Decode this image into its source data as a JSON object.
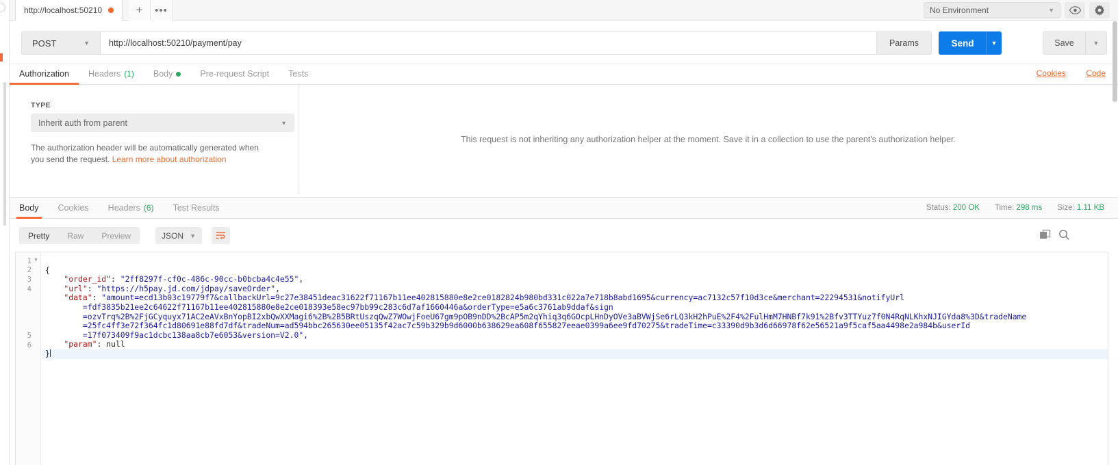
{
  "window": {
    "tab_label": "http://localhost:50210",
    "new_tab_icon": "+",
    "more_tabs_icon": "•••",
    "environment": "No Environment",
    "eye_icon": "eye-icon",
    "gear_icon": "gear-icon"
  },
  "request": {
    "method": "POST",
    "url": "http://localhost:50210/payment/pay",
    "params_label": "Params",
    "send_label": "Send",
    "save_label": "Save",
    "tabs": [
      {
        "label": "Authorization",
        "badge": ""
      },
      {
        "label": "Headers",
        "badge": "(1)"
      },
      {
        "label": "Body",
        "badge": ""
      },
      {
        "label": "Pre-request Script",
        "badge": ""
      },
      {
        "label": "Tests",
        "badge": ""
      }
    ],
    "cookies_link": "Cookies",
    "code_link": "Code"
  },
  "auth": {
    "type_label": "TYPE",
    "type_value": "Inherit auth from parent",
    "note_text": "The authorization header will be automatically generated when you send the request. ",
    "note_link": "Learn more about authorization",
    "right_message": "This request is not inheriting any authorization helper at the moment. Save it in a collection to use the parent's authorization helper."
  },
  "response": {
    "tabs": [
      {
        "label": "Body",
        "badge": ""
      },
      {
        "label": "Cookies",
        "badge": ""
      },
      {
        "label": "Headers",
        "badge": "(6)"
      },
      {
        "label": "Test Results",
        "badge": ""
      }
    ],
    "status_label": "Status:",
    "status_value": "200 OK",
    "time_label": "Time:",
    "time_value": "298 ms",
    "size_label": "Size:",
    "size_value": "1.11 KB",
    "view_modes": [
      "Pretty",
      "Raw",
      "Preview"
    ],
    "active_view": "Pretty",
    "format": "JSON",
    "wrap_icon": "word-wrap-icon",
    "copy_icon": "copy-icon",
    "search_icon": "search-icon"
  },
  "body_json": {
    "line_numbers": [
      "1",
      "2",
      "3",
      "4",
      "5",
      "6"
    ],
    "lines": [
      "{",
      "    \"order_id\": \"2ff8297f-cf0c-486c-90cc-b0bcba4c4e55\",",
      "    \"url\": \"https://h5pay.jd.com/jdpay/saveOrder\",",
      "    \"data\": \"amount=ecd13b03c19779f7&callbackUrl=9c27e38451deac31622f71167b11ee402815880e8e2ce0182824b980bd331c022a7e718b8abd1695&currency=ac7132c57f10d3ce&merchant=22294531&notifyUrl",
      "        =fdf3835b21ee2c64622f71167b11ee402815880e8e2ce018393e58ec97bb99c283c6d7af1660446a&orderType=e5a6c3761ab9ddaf&sign",
      "        =ozvTrq%2B%2FjGCyquyx71AC2eAVxBnYopBI2xbQwXXMagi6%2B%2B5BRtUszqQwZ7WOwjFoeU67gm9pOB9nDD%2BcAP5m2qYhiq3q6GOcpLHnDyOVe3aBVWjSe6rLQ3kH2hPuE%2F4%2FulHmM7HNBf7k91%2Bfv3TTYuz7f0N4RqNLKhxNJIGYda8%3D&tradeName",
      "        =25fc4ff3e72f364fc1d80691e88fd7df&tradeNum=ad594bbc265630ee05135f42ac7c59b329b9d6000b638629ea608f655827eeae0399a6ee9fd70275&tradeTime=c33390d9b3d6d66978f62e56521a9f5caf5aa4498e2a984b&userId",
      "        =17f073409f9ac1dcbc138aa8cb7e6053&version=V2.0\",",
      "    \"param\": null",
      "}"
    ],
    "keys": [
      "order_id",
      "url",
      "data",
      "param"
    ],
    "values": {
      "order_id": "2ff8297f-cf0c-486c-90cc-b0bcba4c4e55",
      "url": "https://h5pay.jd.com/jdpay/saveOrder",
      "param": "null"
    }
  },
  "colors": {
    "accent_orange": "#f26b3a",
    "send_blue": "#0d7ce8",
    "status_green": "#2aa860",
    "json_blue": "#1a1a9c",
    "json_key_red": "#aa1111"
  }
}
